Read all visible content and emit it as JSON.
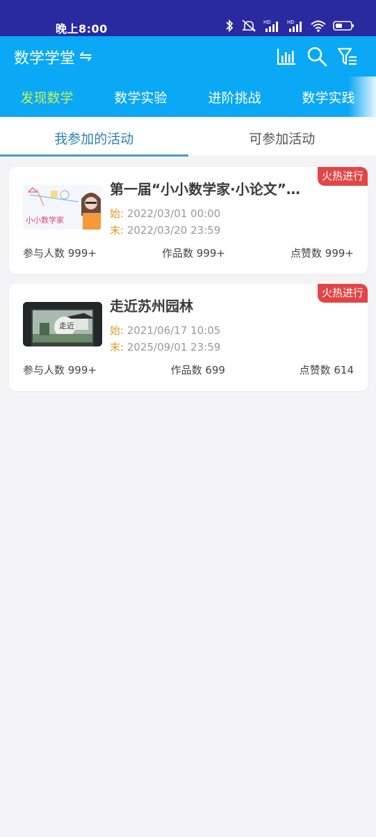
{
  "status_bar": {
    "time": "晚上8:00"
  },
  "header": {
    "title": "数学学堂",
    "swap_icon": "⇋"
  },
  "category_tabs": [
    {
      "label": "发现数学"
    },
    {
      "label": "数学实验"
    },
    {
      "label": "进阶挑战"
    },
    {
      "label": "数学实践"
    }
  ],
  "sub_tabs": [
    {
      "label": "我参加的活动"
    },
    {
      "label": "可参加活动"
    }
  ],
  "activities": [
    {
      "title": "第一届“小小数学家·小论文”…",
      "badge": "火热进行",
      "start_label": "始:",
      "start": "2022/03/01 00:00",
      "end_label": "末:",
      "end": "2022/03/20 23:59",
      "participants": "参与人数 999+",
      "works": "作品数 999+",
      "likes": "点赞数 999+",
      "thumb_text": "小小数学家"
    },
    {
      "title": "走近苏州园林",
      "badge": "火热进行",
      "start_label": "始:",
      "start": "2021/06/17 10:05",
      "end_label": "末:",
      "end": "2025/09/01 23:59",
      "participants": "参与人数 999+",
      "works": "作品数 699",
      "likes": "点赞数 614",
      "thumb_text": "走近"
    }
  ],
  "colors": {
    "status_bar": "#2a2aa0",
    "header": "#0aa8f5",
    "active_category": "#c7f25a",
    "active_subtab": "#2d7fb3",
    "badge": "#e34545",
    "time_label": "#e29a23"
  }
}
